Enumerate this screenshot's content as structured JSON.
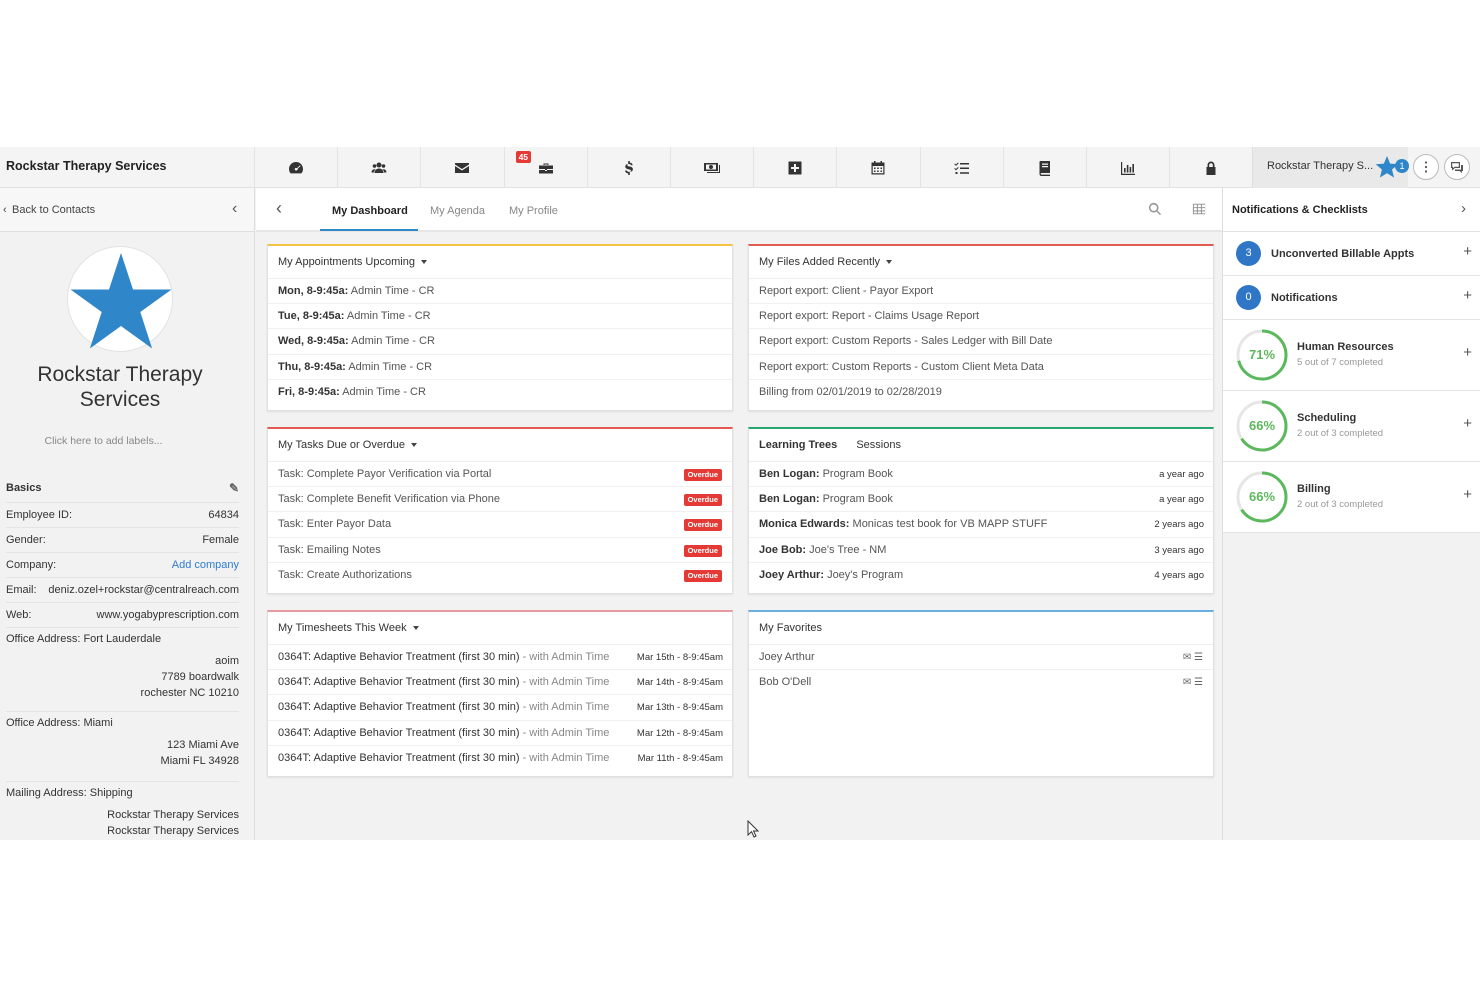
{
  "app": {
    "brand": "Rockstar Therapy Services",
    "account_name": "Rockstar Therapy S...",
    "account_badge": "1",
    "briefcase_badge": "45"
  },
  "nav_icons": [
    "dashboard-icon",
    "users-icon",
    "envelope-icon",
    "briefcase-icon",
    "dollar-icon",
    "money-icon",
    "medical-plus-icon",
    "calendar-icon",
    "tasks-icon",
    "book-icon",
    "chart-icon",
    "lock-icon"
  ],
  "left": {
    "back_label": "Back to Contacts",
    "org_name": "Rockstar Therapy Services",
    "add_labels": "Click here to add labels...",
    "basics_title": "Basics",
    "fields": [
      {
        "label": "Employee ID:",
        "value": "64834"
      },
      {
        "label": "Gender:",
        "value": "Female"
      },
      {
        "label": "Company:",
        "value": "Add company"
      },
      {
        "label": "Email:",
        "value": "deniz.ozel+rockstar@centralreach.com"
      },
      {
        "label": "Web:",
        "value": "www.yogabyprescription.com"
      }
    ],
    "addresses": [
      {
        "title": "Office Address: Fort Lauderdale",
        "lines": [
          "aoim",
          "7789 boardwalk",
          "rochester NC 10210"
        ]
      },
      {
        "title": "Office Address: Miami",
        "lines": [
          "123 Miami Ave",
          "Miami FL 34928"
        ]
      },
      {
        "title": "Mailing Address: Shipping",
        "lines": [
          "Rockstar Therapy Services",
          "Rockstar Therapy Services"
        ]
      }
    ]
  },
  "tabs": [
    {
      "label": "My Dashboard"
    },
    {
      "label": "My Agenda"
    },
    {
      "label": "My Profile"
    }
  ],
  "cards": {
    "appointments": {
      "title": "My Appointments Upcoming",
      "rows": [
        {
          "day": "Mon, 8-9:45a:",
          "desc": "Admin Time - CR"
        },
        {
          "day": "Tue, 8-9:45a:",
          "desc": "Admin Time - CR"
        },
        {
          "day": "Wed, 8-9:45a:",
          "desc": "Admin Time - CR"
        },
        {
          "day": "Thu, 8-9:45a:",
          "desc": "Admin Time - CR"
        },
        {
          "day": "Fri, 8-9:45a:",
          "desc": "Admin Time - CR"
        }
      ]
    },
    "files": {
      "title": "My Files Added Recently",
      "rows": [
        "Report export: Client - Payor Export",
        "Report export: Report - Claims Usage Report",
        "Report export: Custom Reports - Sales Ledger with Bill Date",
        "Report export: Custom Reports - Custom Client Meta Data",
        "Billing from 02/01/2019 to 02/28/2019"
      ]
    },
    "tasks": {
      "title": "My Tasks Due or Overdue",
      "badge": "Overdue",
      "rows": [
        "Task: Complete Payor Verification via Portal",
        "Task: Complete Benefit Verification via Phone",
        "Task: Enter Payor Data",
        "Task: Emailing Notes",
        "Task: Create Authorizations"
      ]
    },
    "learning": {
      "title": "Learning Trees",
      "tab2": "Sessions",
      "rows": [
        {
          "name": "Ben Logan:",
          "item": "Program Book",
          "when": "a year ago"
        },
        {
          "name": "Ben Logan:",
          "item": "Program Book",
          "when": "a year ago"
        },
        {
          "name": "Monica Edwards:",
          "item": "Monicas test book for VB MAPP STUFF",
          "when": "2 years ago"
        },
        {
          "name": "Joe Bob:",
          "item": "Joe's Tree - NM",
          "when": "3 years ago"
        },
        {
          "name": "Joey Arthur:",
          "item": "Joey's Program",
          "when": "4 years ago"
        }
      ]
    },
    "timesheets": {
      "title": "My Timesheets This Week",
      "with": "- with Admin Time",
      "service": "0364T: Adaptive Behavior Treatment (first 30 min)",
      "rows": [
        {
          "date": "Mar 15th - 8-9:45am"
        },
        {
          "date": "Mar 14th - 8-9:45am"
        },
        {
          "date": "Mar 13th - 8-9:45am"
        },
        {
          "date": "Mar 12th - 8-9:45am"
        },
        {
          "date": "Mar 11th - 8-9:45am"
        }
      ]
    },
    "favorites": {
      "title": "My Favorites",
      "rows": [
        "Joey Arthur",
        "Bob O'Dell"
      ]
    }
  },
  "right": {
    "title": "Notifications & Checklists",
    "counters": [
      {
        "count": "3",
        "label": "Unconverted Billable Appts"
      },
      {
        "count": "0",
        "label": "Notifications"
      }
    ],
    "checklists": [
      {
        "pct": "71%",
        "progress": 0.71,
        "title": "Human Resources",
        "sub": "5 out of 7 completed"
      },
      {
        "pct": "66%",
        "progress": 0.66,
        "title": "Scheduling",
        "sub": "2 out of 3 completed"
      },
      {
        "pct": "66%",
        "progress": 0.66,
        "title": "Billing",
        "sub": "2 out of 3 completed"
      }
    ]
  },
  "colors": {
    "accent": "#2f86c9",
    "overdue": "#e53935",
    "progress": "#5cb85c",
    "card_yellow": "#f5c342",
    "card_red": "#e25a52",
    "card_green": "#2aa56f",
    "card_blue": "#6aaee0"
  }
}
